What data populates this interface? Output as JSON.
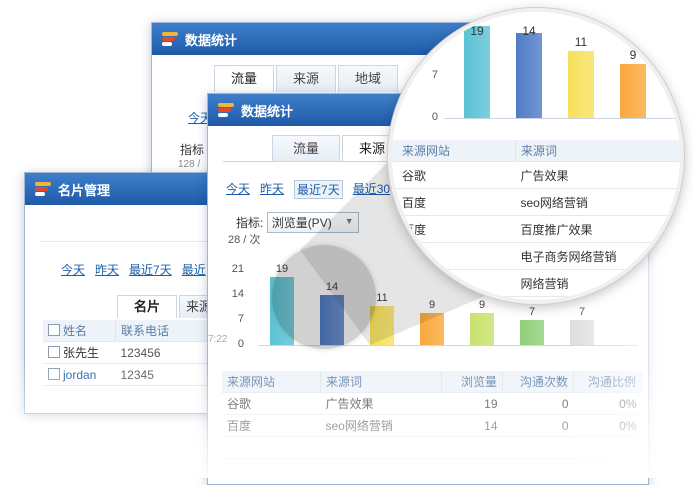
{
  "win_back": {
    "title": "数据统计",
    "tabs": [
      "流量",
      "来源",
      "地域"
    ],
    "filters": [
      "今天"
    ],
    "peek_lines": [
      "指标",
      "128 /"
    ]
  },
  "win_name": {
    "title": "名片管理",
    "filters": [
      "今天",
      "昨天",
      "最近7天",
      "最近"
    ],
    "tabs": [
      "名片",
      "来源"
    ],
    "headers": [
      "姓名",
      "联系电话"
    ],
    "rows": [
      {
        "name": "张先生",
        "phone": "123456"
      },
      {
        "name": "jordan",
        "phone": "12345"
      }
    ]
  },
  "win_main": {
    "title": "数据统计",
    "tabs": [
      "流量",
      "来源"
    ],
    "filters": [
      "今天",
      "昨天",
      "最近7天",
      "最近30"
    ],
    "metric_label": "指标:",
    "metric_value": "浏览量(PV)",
    "headers": [
      "来源网站",
      "来源词",
      "浏览量",
      "沟通次数",
      "沟通比例"
    ],
    "rows": [
      {
        "site": "谷歌",
        "word": "广告效果",
        "pv": "19",
        "comm": "0",
        "ratio": "0%"
      },
      {
        "site": "百度",
        "word": "seo网络营销",
        "pv": "14",
        "comm": "0",
        "ratio": "0%"
      },
      {
        "site": "",
        "word": "",
        "pv": "",
        "comm": "",
        "ratio": ""
      }
    ],
    "peek_left": [
      "2",
      "7:22"
    ]
  },
  "chart_data": {
    "type": "bar",
    "ylabel": "28 / 次",
    "yticks": [
      "28",
      "21",
      "14",
      "7",
      "0"
    ],
    "ylim": [
      0,
      28
    ],
    "values": [
      19,
      14,
      11,
      9,
      9,
      7,
      7
    ],
    "value_labels": [
      "19",
      "14",
      "11",
      "9",
      "9",
      "7",
      "7"
    ],
    "colors": [
      "#5bc2d4",
      "#4f7cc6",
      "#f7e05a",
      "#f9a83c",
      "#c8e26c",
      "#8fcf78",
      "#dadada"
    ]
  },
  "magnifier": {
    "yticks": [
      "14",
      "7",
      "0"
    ],
    "values": [
      19,
      14,
      11,
      9
    ],
    "value_labels": [
      "19",
      "14",
      "11",
      "9"
    ],
    "headers": [
      "来源网站",
      "来源词"
    ],
    "rows": [
      {
        "site": "谷歌",
        "word": "广告效果"
      },
      {
        "site": "百度",
        "word": "seo网络营销"
      },
      {
        "site": "百度",
        "word": "百度推广效果"
      },
      {
        "site": "",
        "word": "电子商务网络营销"
      },
      {
        "site": "",
        "word": "网络营销"
      }
    ]
  }
}
